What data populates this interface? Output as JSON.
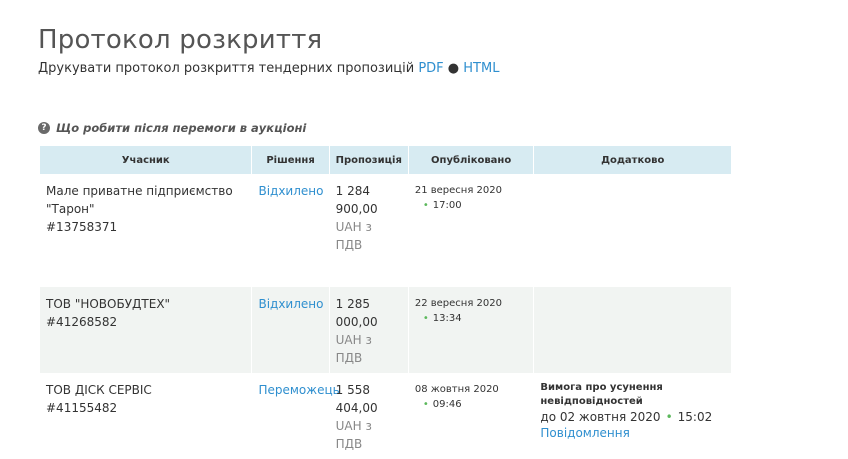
{
  "page": {
    "title": "Протокол розкриття",
    "print_text": "Друкувати протокол розкриття тендерних пропозицій",
    "print_pdf": "PDF",
    "print_separator": "●",
    "print_html": "HTML",
    "help_icon": "question-circle-icon",
    "help_text": "Що робити після перемоги в аукціоні"
  },
  "table": {
    "headers": [
      "Учасник",
      "Рішення",
      "Пропозиція",
      "Опубліковано",
      "Додатково"
    ],
    "rows": [
      {
        "name_line1": "Мале приватне підприємство",
        "name_line2": "\"Тарон\"",
        "code": "#13758371",
        "decision": "Відхилено",
        "amount_line1": "1 284",
        "amount_line2": "900,00",
        "vat_line1": "UAH з",
        "vat_line2": "ПДВ",
        "date": "21 вересня 2020",
        "time": "17:00"
      },
      {
        "name_line1": "ТОВ \"НОВОБУДТЕХ\"",
        "code": "#41268582",
        "decision": "Відхилено",
        "amount_line1": "1 285",
        "amount_line2": "000,00",
        "vat_line1": "UAH з",
        "vat_line2": "ПДВ",
        "date": "22 вересня 2020",
        "time": "13:34"
      },
      {
        "name_line1": "ТОВ ДІСК СЕРВІС",
        "code": "#41155482",
        "decision": "Переможець",
        "amount_line1": "1 558",
        "amount_line2": "404,00",
        "vat_line1": "UAH з",
        "vat_line2": "ПДВ",
        "date": "08 жовтня 2020",
        "time": "09:46",
        "extra_title_line1": "Вимога про усунення",
        "extra_title_line2": "невідповідностей",
        "extra_deadline_date": "до 02 жовтня 2020",
        "extra_deadline_time": "15:02",
        "extra_link": "Повідомлення"
      }
    ]
  }
}
